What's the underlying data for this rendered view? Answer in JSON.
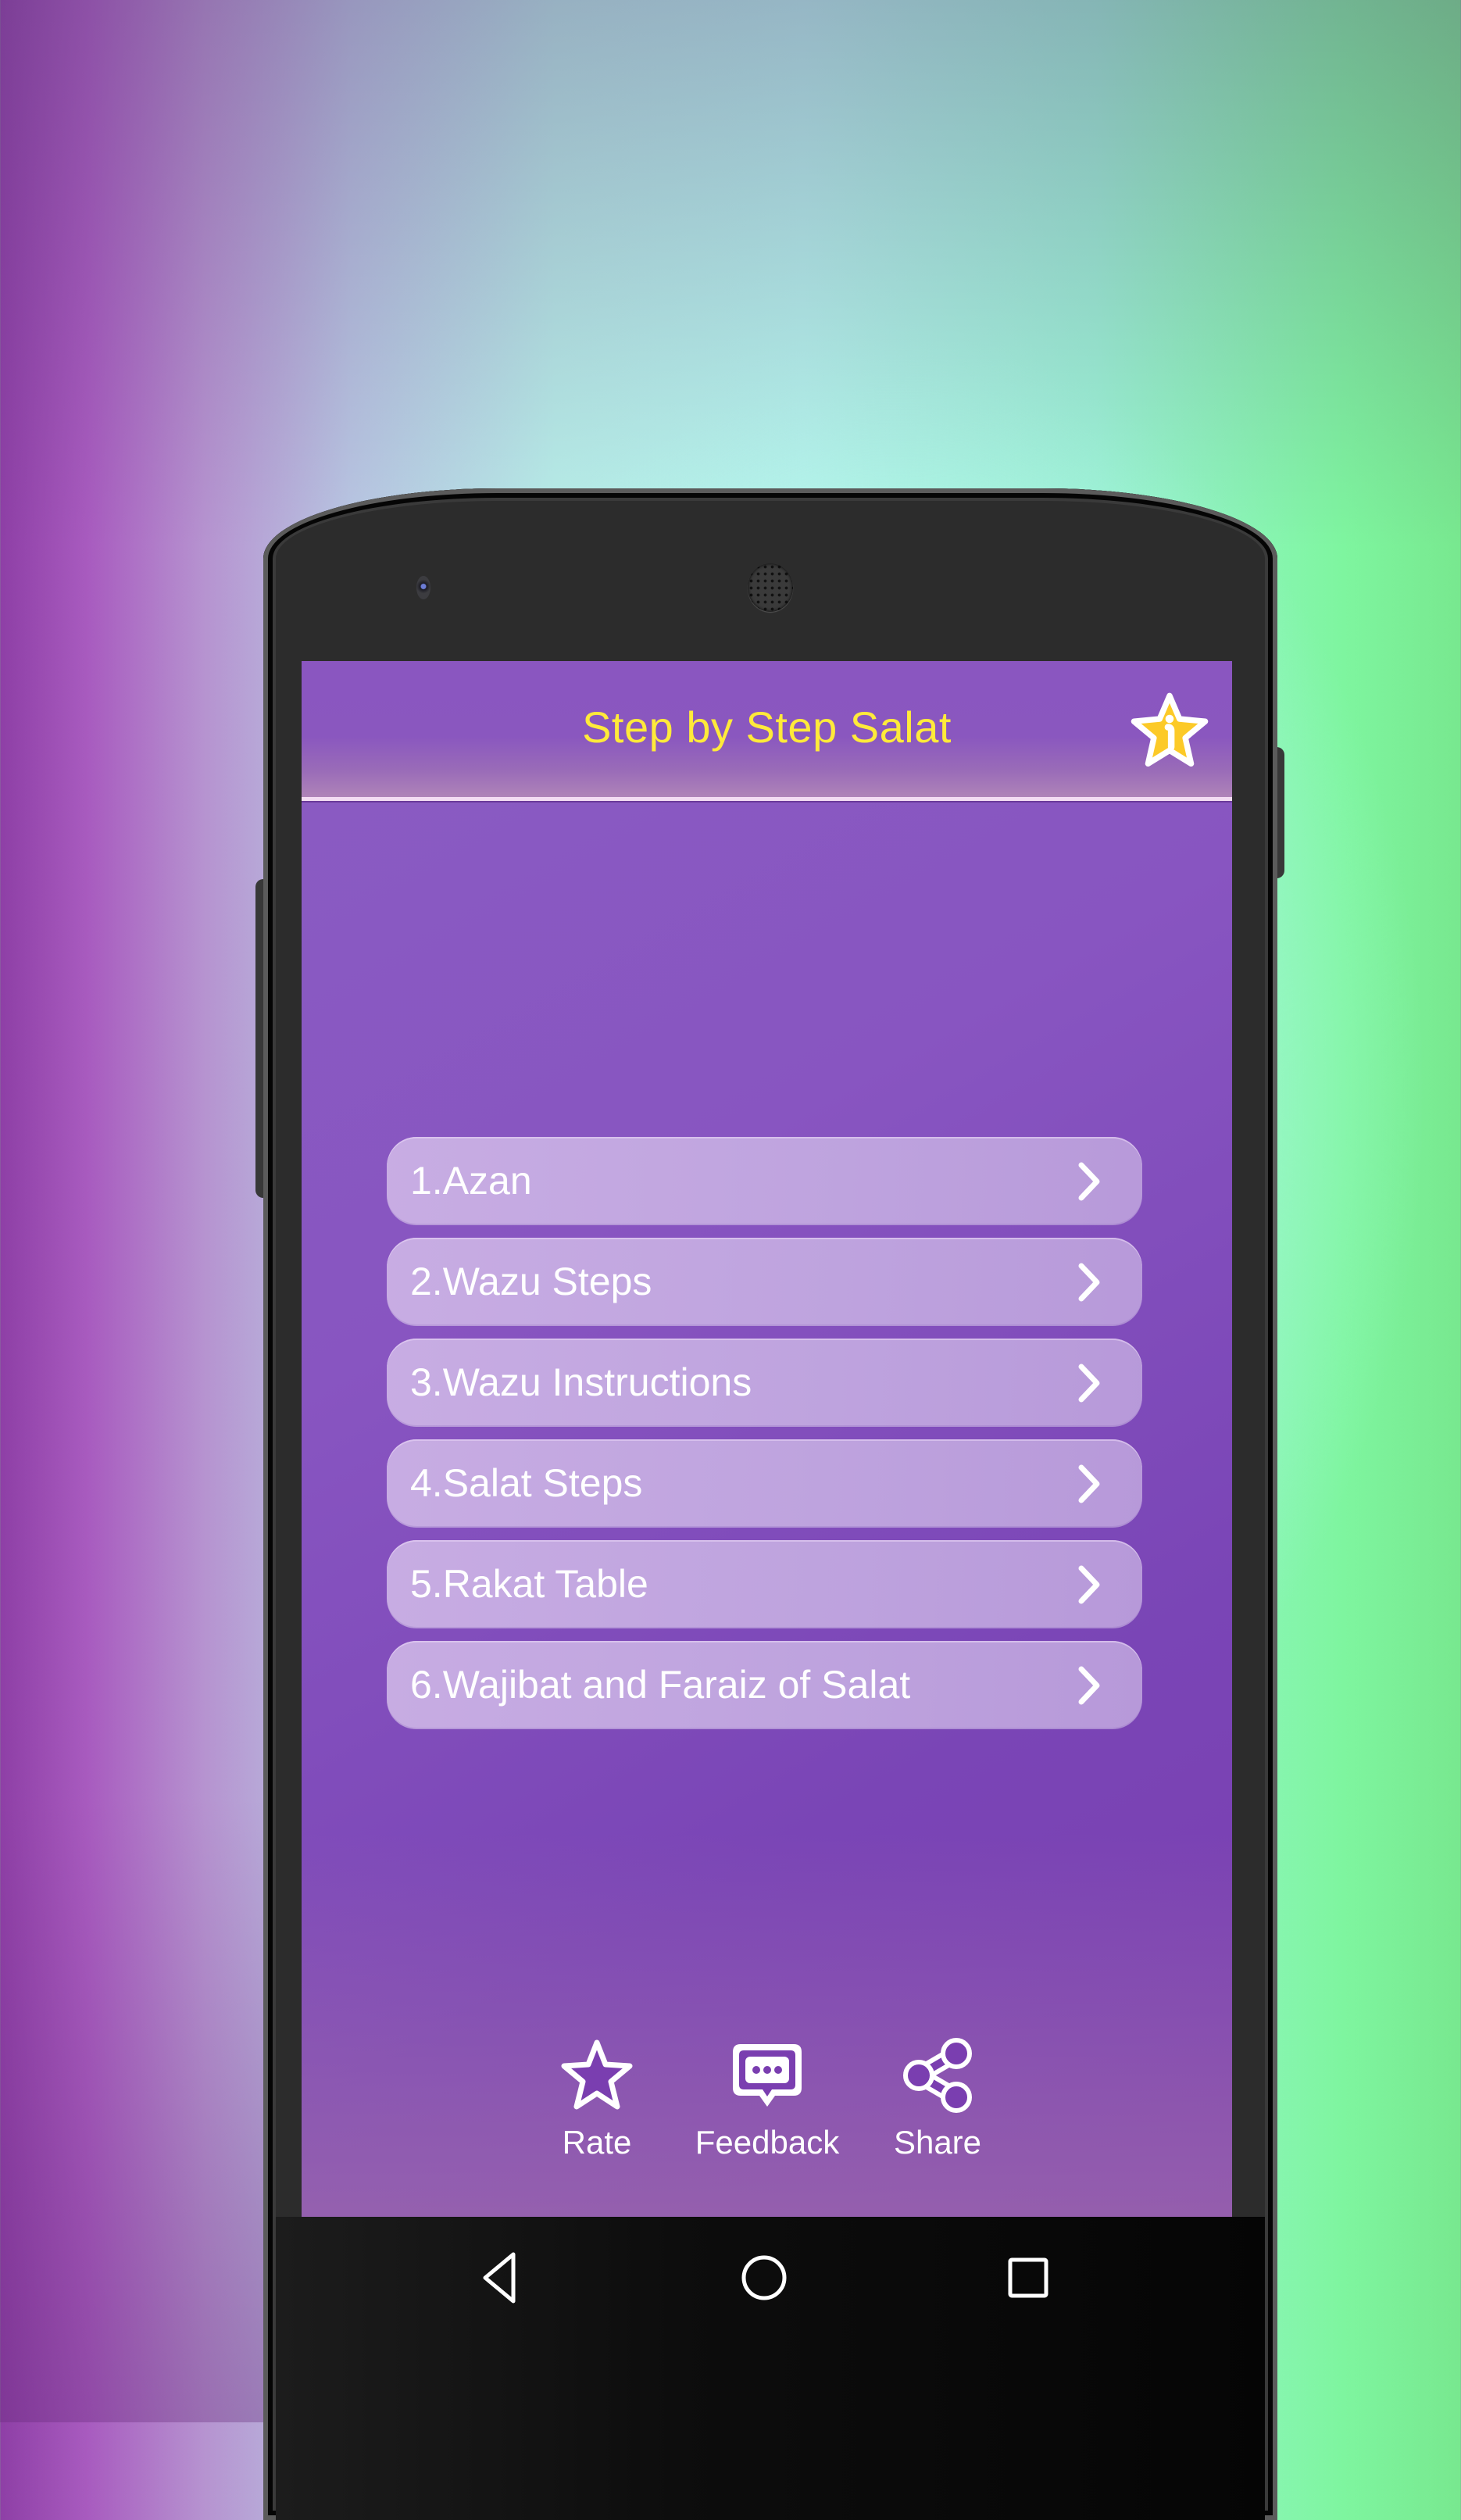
{
  "app": {
    "title": "Step by Step Salat",
    "title_color": "#ffea3a",
    "accent_color": "#8855c1"
  },
  "header": {
    "title": "Step by Step Salat",
    "info_icon": "info-star-icon"
  },
  "menu": {
    "items": [
      {
        "label": "1.Azan",
        "icon": "chevron-right-icon"
      },
      {
        "label": "2.Wazu Steps",
        "icon": "chevron-right-icon"
      },
      {
        "label": "3.Wazu Instructions",
        "icon": "chevron-right-icon"
      },
      {
        "label": "4.Salat Steps",
        "icon": "chevron-right-icon"
      },
      {
        "label": "5.Rakat Table",
        "icon": "chevron-right-icon"
      },
      {
        "label": "6.Wajibat and Faraiz of Salat",
        "icon": "chevron-right-icon"
      }
    ]
  },
  "actions": [
    {
      "label": "Rate",
      "icon": "star-icon"
    },
    {
      "label": "Feedback",
      "icon": "chat-bubble-icon"
    },
    {
      "label": "Share",
      "icon": "share-icon"
    }
  ],
  "navbar": {
    "back_icon": "back-triangle-icon",
    "home_icon": "home-circle-icon",
    "recents_icon": "recents-square-icon"
  }
}
